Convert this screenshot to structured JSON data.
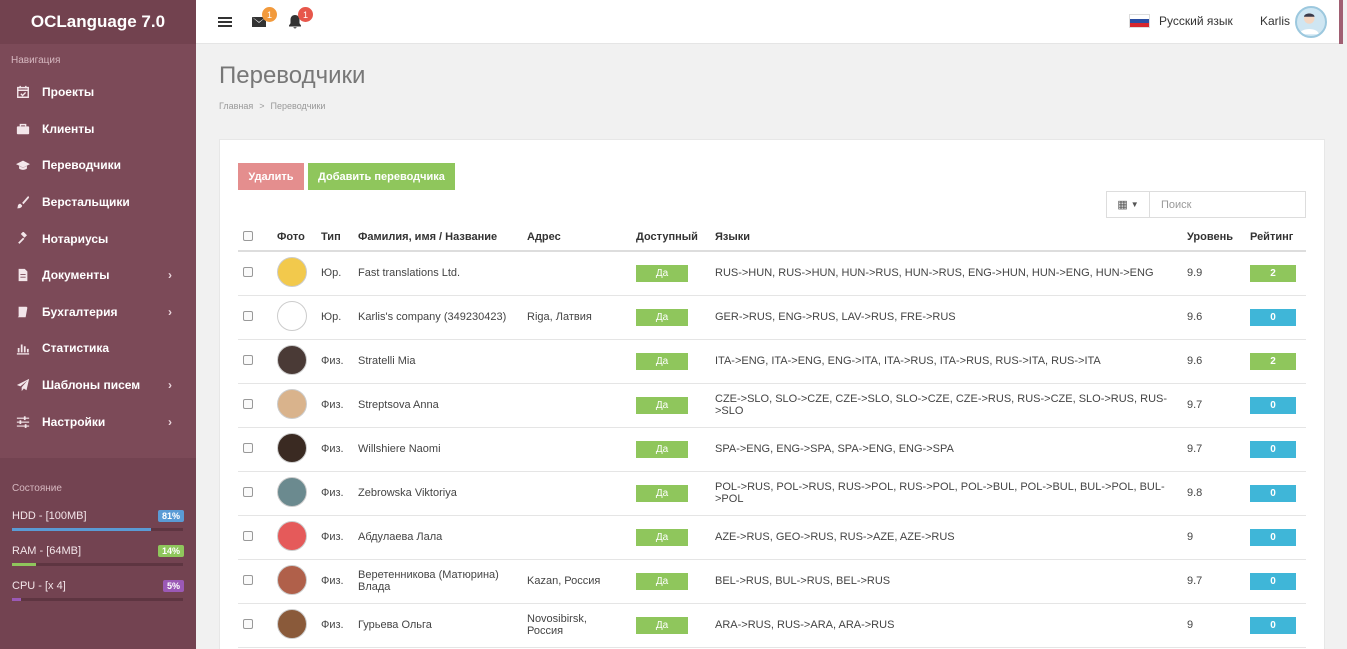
{
  "app": {
    "title": "OCLanguage 7.0"
  },
  "sidebar": {
    "nav_header": "Навигация",
    "items": [
      {
        "label": "Проекты",
        "icon": "calendar-check-icon",
        "has_children": false
      },
      {
        "label": "Клиенты",
        "icon": "briefcase-icon",
        "has_children": false
      },
      {
        "label": "Переводчики",
        "icon": "graduation-cap-icon",
        "has_children": false
      },
      {
        "label": "Верстальщики",
        "icon": "paint-brush-icon",
        "has_children": false
      },
      {
        "label": "Нотариусы",
        "icon": "gavel-icon",
        "has_children": false
      },
      {
        "label": "Документы",
        "icon": "document-icon",
        "has_children": true
      },
      {
        "label": "Бухгалтерия",
        "icon": "book-icon",
        "has_children": true
      },
      {
        "label": "Статистика",
        "icon": "bar-chart-icon",
        "has_children": false
      },
      {
        "label": "Шаблоны писем",
        "icon": "paper-plane-icon",
        "has_children": true
      },
      {
        "label": "Настройки",
        "icon": "sliders-icon",
        "has_children": true
      }
    ],
    "status": {
      "title": "Состояние",
      "meters": [
        {
          "label": "HDD - [100MB]",
          "badge": "81%",
          "value": 0.81,
          "color": "#5a9bd5"
        },
        {
          "label": "RAM - [64MB]",
          "badge": "14%",
          "value": 0.14,
          "color": "#8fc65c"
        },
        {
          "label": "CPU - [x 4]",
          "badge": "5%",
          "value": 0.05,
          "color": "#9b59b6"
        }
      ]
    }
  },
  "topbar": {
    "messages_count": "1",
    "notifications_count": "1",
    "language": "Русский язык",
    "user": "Karlis"
  },
  "page": {
    "title": "Переводчики",
    "breadcrumb": [
      "Главная",
      "Переводчики"
    ]
  },
  "toolbar": {
    "delete_label": "Удалить",
    "add_label": "Добавить переводчика",
    "search_placeholder": "Поиск"
  },
  "table": {
    "columns": [
      "Фото",
      "Тип",
      "Фамилия, имя / Название",
      "Адрес",
      "Доступный",
      "Языки",
      "Уровень",
      "Рейтинг"
    ],
    "rows": [
      {
        "type": "Юр.",
        "name": "Fast translations Ltd.",
        "address": "",
        "available": "Да",
        "languages": "RUS->HUN, RUS->HUN, HUN->RUS, HUN->RUS, ENG->HUN, HUN->ENG, HUN->ENG",
        "level": "9.9",
        "rating": "2",
        "rating_color": "#8fc65c",
        "photo_color": "#f2c94c"
      },
      {
        "type": "Юр.",
        "name": "Karlis's company (349230423)",
        "address": "Riga, Латвия",
        "available": "Да",
        "languages": "GER->RUS, ENG->RUS, LAV->RUS, FRE->RUS",
        "level": "9.6",
        "rating": "0",
        "rating_color": "#3fb6d8",
        "photo_color": "#ffffff"
      },
      {
        "type": "Физ.",
        "name": "Stratelli Mia",
        "address": "",
        "available": "Да",
        "languages": "ITA->ENG, ITA->ENG, ENG->ITA, ITA->RUS, ITA->RUS, RUS->ITA, RUS->ITA",
        "level": "9.6",
        "rating": "2",
        "rating_color": "#8fc65c",
        "photo_color": "#4a3a36"
      },
      {
        "type": "Физ.",
        "name": "Streptsova Anna",
        "address": "",
        "available": "Да",
        "languages": "CZE->SLO, SLO->CZE, CZE->SLO, SLO->CZE, CZE->RUS, RUS->CZE, SLO->RUS, RUS->SLO",
        "level": "9.7",
        "rating": "0",
        "rating_color": "#3fb6d8",
        "photo_color": "#d9b38c"
      },
      {
        "type": "Физ.",
        "name": "Willshiere Naomi",
        "address": "",
        "available": "Да",
        "languages": "SPA->ENG, ENG->SPA, SPA->ENG, ENG->SPA",
        "level": "9.7",
        "rating": "0",
        "rating_color": "#3fb6d8",
        "photo_color": "#3a2a22"
      },
      {
        "type": "Физ.",
        "name": "Zebrowska Viktoriya",
        "address": "",
        "available": "Да",
        "languages": "POL->RUS, POL->RUS, RUS->POL, RUS->POL, POL->BUL, POL->BUL, BUL->POL, BUL->POL",
        "level": "9.8",
        "rating": "0",
        "rating_color": "#3fb6d8",
        "photo_color": "#6b8a8f"
      },
      {
        "type": "Физ.",
        "name": "Абдулаева Лала",
        "address": "",
        "available": "Да",
        "languages": "AZE->RUS, GEO->RUS, RUS->AZE, AZE->RUS",
        "level": "9",
        "rating": "0",
        "rating_color": "#3fb6d8",
        "photo_color": "#e55a5a"
      },
      {
        "type": "Физ.",
        "name": "Веретенникова (Матюрина) Влада",
        "address": "Kazan, Россия",
        "available": "Да",
        "languages": "BEL->RUS, BUL->RUS, BEL->RUS",
        "level": "9.7",
        "rating": "0",
        "rating_color": "#3fb6d8",
        "photo_color": "#b0604a"
      },
      {
        "type": "Физ.",
        "name": "Гурьева Ольга",
        "address": "Novosibirsk, Россия",
        "available": "Да",
        "languages": "ARA->RUS, RUS->ARA, ARA->RUS",
        "level": "9",
        "rating": "0",
        "rating_color": "#3fb6d8",
        "photo_color": "#8a5a3a"
      }
    ]
  }
}
